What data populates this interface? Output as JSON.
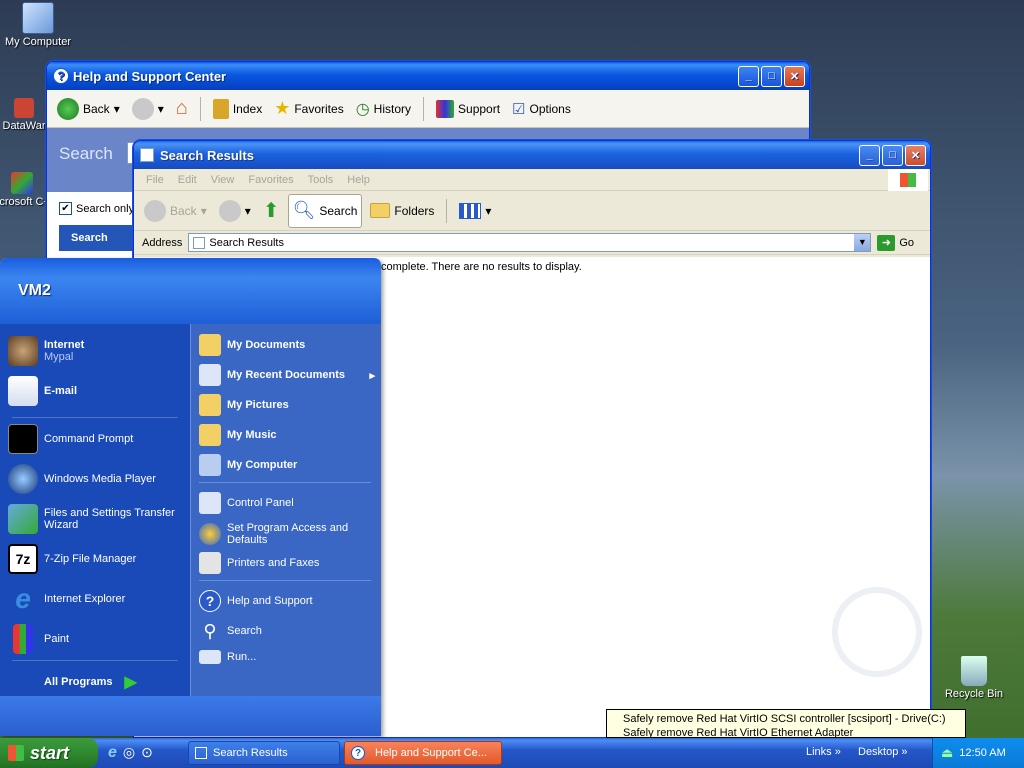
{
  "desktop": {
    "icons": [
      {
        "label": "My Computer"
      },
      {
        "label": "DataWar"
      },
      {
        "label": "Microsoft C++"
      },
      {
        "label": "Recycle Bin"
      }
    ]
  },
  "help_window": {
    "title": "Help and Support Center",
    "toolbar": {
      "back": "Back",
      "index": "Index",
      "favorites": "Favorites",
      "history": "History",
      "support": "Support",
      "options": "Options"
    },
    "search_label": "Search",
    "search_only": "Search only",
    "search_button": "Search"
  },
  "search_window": {
    "title": "Search Results",
    "menu": [
      "File",
      "Edit",
      "View",
      "Favorites",
      "Tools",
      "Help"
    ],
    "toolbar": {
      "back": "Back",
      "search": "Search",
      "folders": "Folders"
    },
    "address_label": "Address",
    "address_value": "Search Results",
    "go": "Go",
    "message": "is complete. There are no results to display."
  },
  "start_menu": {
    "user": "VM2",
    "left_pinned": [
      {
        "label": "Internet",
        "sub": "Mypal"
      },
      {
        "label": "E-mail",
        "sub": ""
      }
    ],
    "left_recent": [
      {
        "label": "Command Prompt"
      },
      {
        "label": "Windows Media Player"
      },
      {
        "label": "Files and Settings Transfer Wizard"
      },
      {
        "label": "7-Zip File Manager"
      },
      {
        "label": "Internet Explorer"
      },
      {
        "label": "Paint"
      }
    ],
    "all_programs": "All Programs",
    "right_places": [
      {
        "label": "My Documents"
      },
      {
        "label": "My Recent Documents"
      },
      {
        "label": "My Pictures"
      },
      {
        "label": "My Music"
      },
      {
        "label": "My Computer"
      }
    ],
    "right_system": [
      {
        "label": "Control Panel"
      },
      {
        "label": "Set Program Access and Defaults"
      },
      {
        "label": "Printers and Faxes"
      },
      {
        "label": "Help and Support"
      },
      {
        "label": "Search"
      },
      {
        "label": "Run..."
      }
    ]
  },
  "tooltip": {
    "line1": "Safely remove Red Hat VirtIO SCSI controller [scsiport] - Drive(C:)",
    "line2": "Safely remove Red Hat VirtIO Ethernet Adapter"
  },
  "taskbar": {
    "start": "start",
    "tasks": [
      "Search Results",
      "Help and Support Ce..."
    ],
    "links": "Links",
    "desktop": "Desktop",
    "clock": "12:50 AM"
  }
}
